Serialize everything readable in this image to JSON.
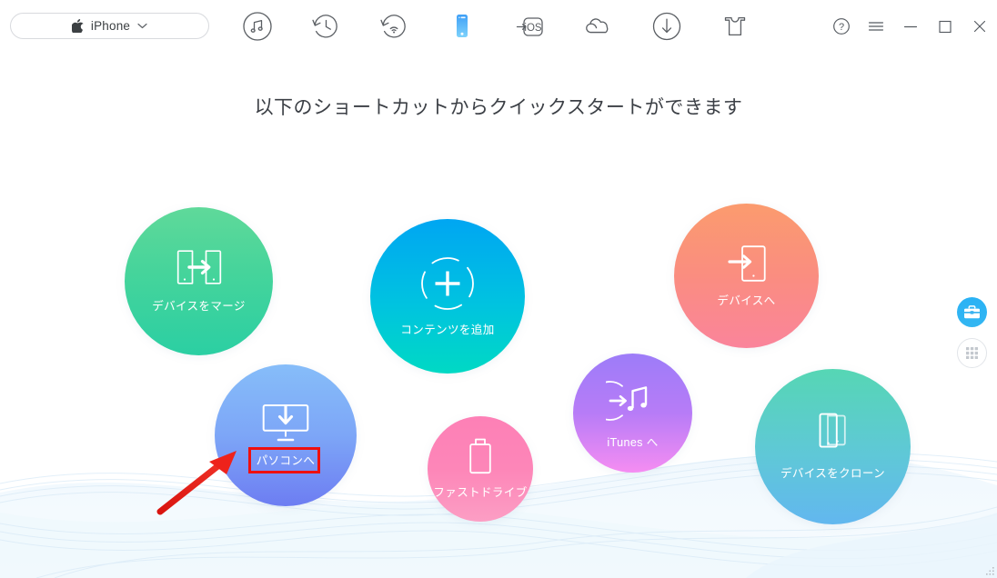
{
  "window": {
    "device_selector": {
      "label": "iPhone",
      "apple_icon": "apple-logo-icon",
      "chevron": "chevron-down-icon"
    },
    "controls": [
      {
        "name": "help-button",
        "icon": "question-circle-icon",
        "glyph": "?"
      },
      {
        "name": "menu-button",
        "icon": "hamburger-menu-icon",
        "glyph": "≡"
      },
      {
        "name": "minimize-button",
        "icon": "minimize-icon",
        "glyph": "−"
      },
      {
        "name": "maximize-button",
        "icon": "maximize-square-icon",
        "glyph": "□"
      },
      {
        "name": "close-button",
        "icon": "close-x-icon",
        "glyph": "✕"
      }
    ]
  },
  "toolbar": {
    "items": [
      {
        "name": "tool-music",
        "icon": "music-note-circle-icon",
        "active": false
      },
      {
        "name": "tool-backup",
        "icon": "clock-restore-icon",
        "active": false
      },
      {
        "name": "tool-airtrans",
        "icon": "wireless-transfer-icon",
        "active": false
      },
      {
        "name": "tool-device",
        "icon": "phone-device-icon",
        "active": true
      },
      {
        "name": "tool-ios",
        "icon": "to-ios-icon",
        "active": false,
        "text": "iOS"
      },
      {
        "name": "tool-cloud",
        "icon": "cloud-icon",
        "active": false
      },
      {
        "name": "tool-download",
        "icon": "download-circle-icon",
        "active": false
      },
      {
        "name": "tool-apps",
        "icon": "tshirt-apps-icon",
        "active": false
      }
    ]
  },
  "main": {
    "title": "以下のショートカットからクイックスタートができます",
    "shortcuts": [
      {
        "id": "merge",
        "label": "デバイスをマージ",
        "icon": "two-phones-arrow-icon",
        "color_from": "#5fd99a",
        "color_to": "#2bcfa3"
      },
      {
        "id": "add",
        "label": "コンテンツを追加",
        "icon": "dashed-circle-plus-icon",
        "color_from": "#00a6f2",
        "color_to": "#00d9c4"
      },
      {
        "id": "todevice",
        "label": "デバイスへ",
        "icon": "phone-arrow-in-icon",
        "color_from": "#fb9b6e",
        "color_to": "#fa849b"
      },
      {
        "id": "topc",
        "label": "パソコンへ",
        "icon": "monitor-download-icon",
        "color_from": "#86bdf9",
        "color_to": "#6d7df2",
        "highlighted": true
      },
      {
        "id": "fastdrive",
        "label": "ファストドライブ",
        "icon": "usb-drive-icon",
        "color_from": "#fd80b6",
        "color_to": "#fc9ec4"
      },
      {
        "id": "itunes",
        "label": "iTunes へ",
        "icon": "music-note-arrow-circle-icon",
        "color_from": "#9d7cf8",
        "color_to": "#f58df2"
      },
      {
        "id": "clone",
        "label": "デバイスをクローン",
        "icon": "two-phones-clone-icon",
        "color_from": "#56d6b4",
        "color_to": "#62b7ef"
      }
    ]
  },
  "floating_buttons": [
    {
      "name": "toolbox-button",
      "icon": "toolbox-icon",
      "color": "#2ab2f5"
    },
    {
      "name": "apps-grid-button",
      "icon": "grid-apps-icon",
      "color": "#ffffff"
    }
  ],
  "annotation": {
    "highlight_color": "#ef0f0f",
    "arrow_color": "#e8221a",
    "target": "パソコンへ"
  }
}
